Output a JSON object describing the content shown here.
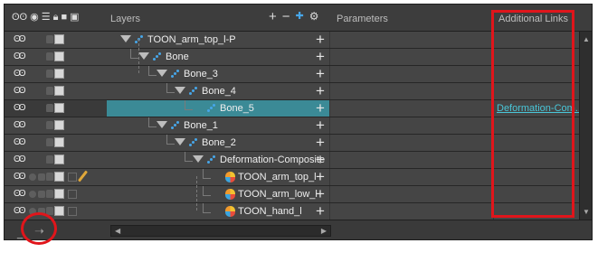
{
  "header": {
    "layers_label": "Layers",
    "parameters_label": "Parameters",
    "additional_links_label": "Additional Links",
    "column_icons": [
      "show-hide-icon",
      "solo-icon",
      "lock-icon",
      "color-icon",
      "scene-toggle-icon"
    ],
    "tool_icons": [
      "add-layer-icon",
      "delete-layer-icon",
      "add-peg-icon",
      "add-deformer-icon"
    ]
  },
  "layers": [
    {
      "name": "TOON_arm_top_l-P",
      "type": "peg",
      "depth": 0,
      "expanded": true
    },
    {
      "name": "Bone",
      "type": "peg",
      "depth": 1,
      "expanded": true
    },
    {
      "name": "Bone_3",
      "type": "peg",
      "depth": 2,
      "expanded": true
    },
    {
      "name": "Bone_4",
      "type": "peg",
      "depth": 3,
      "expanded": true
    },
    {
      "name": "Bone_5",
      "type": "peg",
      "depth": 4,
      "selected": true,
      "link": "Deformation-Com..."
    },
    {
      "name": "Bone_1",
      "type": "peg",
      "depth": 2,
      "expanded": true
    },
    {
      "name": "Bone_2",
      "type": "peg",
      "depth": 3,
      "expanded": true
    },
    {
      "name": "Deformation-Composite",
      "type": "peg",
      "depth": 4,
      "expanded": true
    },
    {
      "name": "TOON_arm_top_l",
      "type": "drawing",
      "depth": 5
    },
    {
      "name": "TOON_arm_low_l",
      "type": "drawing",
      "depth": 5
    },
    {
      "name": "TOON_hand_l",
      "type": "drawing",
      "depth": 5
    }
  ],
  "colors": {
    "selection": "#3b8a96",
    "link": "#49c6d8",
    "annotation": "#e0151b"
  }
}
